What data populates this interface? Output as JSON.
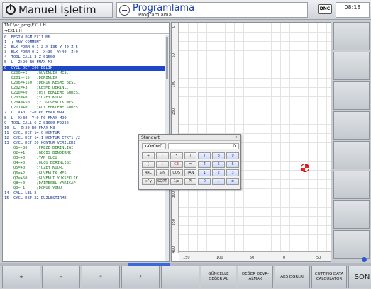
{
  "header": {
    "mode_manual": "Manuel İşletim",
    "mode_program": "Programlama",
    "mode_program_sub": "Programlama",
    "dnc_label": "DNC",
    "clock": "08:18"
  },
  "editor": {
    "path": "TNC:\\nc_prog\\EX11.H",
    "file": "→EX11.H",
    "lines": [
      {
        "text": "0  BEGIN PGM EX11 MM",
        "style": "normal"
      },
      {
        "text": "1  ;-ANY COMMENT",
        "style": "normal"
      },
      {
        "text": "2  BLK FORM 0.1 Z X-135 Y-40 Z-5",
        "style": "normal"
      },
      {
        "text": "3  BLK FORM 0.2  X+30  Y+40  Z+0",
        "style": "normal"
      },
      {
        "text": "4  TOOL CALL 3 Z S1500",
        "style": "normal"
      },
      {
        "text": "5  L  Z+20 R0 FMAX M3",
        "style": "normal"
      },
      {
        "text": "6  CYCL DEF 200 DELIK",
        "style": "sel"
      },
      {
        "text": "   Q200=+2    ;GUVENLIK MES.",
        "style": "sub"
      },
      {
        "text": "   Q201=-15   ;DERINLIK",
        "style": "sub"
      },
      {
        "text": "   Q206=+150  ;DERIN KESME BESL.",
        "style": "sub"
      },
      {
        "text": "   Q202=+3    ;KESME DERINL.",
        "style": "sub"
      },
      {
        "text": "   Q210=+0    ;UST BEKLEME SURESI",
        "style": "sub"
      },
      {
        "text": "   Q203=+0    ;YUZEY KOOR.",
        "style": "sub"
      },
      {
        "text": "   Q204=+50   ;2. GUVENLIK MES.",
        "style": "sub"
      },
      {
        "text": "   Q211=+0    ;ALT BEKLEME SURESI",
        "style": "sub"
      },
      {
        "text": "7  L  X+0  Y+0 R0 FMAX M99",
        "style": "normal"
      },
      {
        "text": "8  L  X+30  Y+0 R0 FMAX M99",
        "style": "normal"
      },
      {
        "text": "9  TOOL CALL 6 Z S3000 F2222",
        "style": "normal"
      },
      {
        "text": "10  L  Z+20 R0 FMAX M3",
        "style": "normal"
      },
      {
        "text": "11  CYCL DEF 14.0 KONTUR",
        "style": "normal"
      },
      {
        "text": "12  CYCL DEF 14.1 KONTUR ETKT1 /2",
        "style": "normal"
      },
      {
        "text": "13  CYCL DEF 20 KONTUR VERILERI",
        "style": "normal"
      },
      {
        "text": "    Q1=-30    ;FREZE DERINLIGI",
        "style": "sub"
      },
      {
        "text": "    Q2=+1     ;GECIS BINDIRME",
        "style": "sub"
      },
      {
        "text": "    Q3=+0     ;YAN OLCU",
        "style": "sub"
      },
      {
        "text": "    Q4=+0     ;OLCU DERINLIGI",
        "style": "sub"
      },
      {
        "text": "    Q5=+0     ;YUZEY KOOR.",
        "style": "sub"
      },
      {
        "text": "    Q6=+2     ;GUVENLIK MES.",
        "style": "sub"
      },
      {
        "text": "    Q7=+50    ;GUVENLI YUKSEKLIK",
        "style": "sub"
      },
      {
        "text": "    Q8=+0     ;DAIRESEL YARICAP",
        "style": "sub"
      },
      {
        "text": "    Q9=-1     ;DONUS YONU",
        "style": "sub"
      },
      {
        "text": "14  CALL LBL 2",
        "style": "normal"
      },
      {
        "text": "15  CYCL DEF 22 DUZLESTIRME",
        "style": "normal"
      }
    ]
  },
  "rulers": {
    "vertical": [
      "0",
      "50",
      "100",
      "150",
      "200",
      "250",
      "300",
      "350",
      "400"
    ],
    "horizontal": [
      "150",
      "100",
      "50",
      "0",
      "50"
    ]
  },
  "calculator": {
    "title": "Standart",
    "close": "x",
    "mode": "GÖrÜntÜ",
    "display": "0.",
    "keys": [
      {
        "label": "+",
        "kind": "op"
      },
      {
        "label": "-",
        "kind": "op"
      },
      {
        "label": "*",
        "kind": "op"
      },
      {
        "label": "/",
        "kind": "op"
      },
      {
        "label": "7",
        "kind": "num"
      },
      {
        "label": "8",
        "kind": "num"
      },
      {
        "label": "9",
        "kind": "num"
      },
      {
        "label": "(",
        "kind": "op"
      },
      {
        "label": ")",
        "kind": "op"
      },
      {
        "label": "CE",
        "kind": "red"
      },
      {
        "label": "=",
        "kind": "op"
      },
      {
        "label": "4",
        "kind": "num"
      },
      {
        "label": "5",
        "kind": "num"
      },
      {
        "label": "6",
        "kind": "num"
      },
      {
        "label": "ARC",
        "kind": "op"
      },
      {
        "label": "SIN",
        "kind": "op"
      },
      {
        "label": "COS",
        "kind": "op"
      },
      {
        "label": "TAN",
        "kind": "op"
      },
      {
        "label": "1",
        "kind": "num"
      },
      {
        "label": "2",
        "kind": "num"
      },
      {
        "label": "3",
        "kind": "num"
      },
      {
        "label": "x^y",
        "kind": "op"
      },
      {
        "label": "SQRT",
        "kind": "op"
      },
      {
        "label": "1/x",
        "kind": "op"
      },
      {
        "label": "PI",
        "kind": "op"
      },
      {
        "label": "0",
        "kind": "num"
      },
      {
        "label": ".",
        "kind": "num"
      },
      {
        "label": "±",
        "kind": "num"
      }
    ]
  },
  "softkeys": [
    {
      "label": "+"
    },
    {
      "label": "-"
    },
    {
      "label": "*"
    },
    {
      "label": "/"
    },
    {
      "label": ""
    },
    {
      "label": "GÜNCELLE DEĞER AL"
    },
    {
      "label": "DEĞER DEVR- ALMAK"
    },
    {
      "label": "AKS DGRLRI"
    },
    {
      "label": "CUTTING DATA CALCULATOR"
    },
    {
      "label": "SON"
    }
  ]
}
